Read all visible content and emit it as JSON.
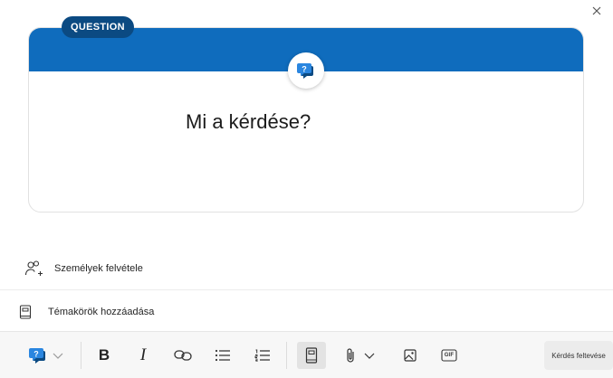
{
  "dialog": {
    "close_icon": "close-icon"
  },
  "card": {
    "badge_label": "QUESTION",
    "question_icon": "question-bubble-icon",
    "question_placeholder": "Mi a kérdése?",
    "question_value": "",
    "colors": {
      "band": "#0f6cbd",
      "badge": "#0b4a82"
    }
  },
  "options": {
    "add_people_label": "Személyek felvétele",
    "add_people_icon": "add-people-icon",
    "add_topics_label": "Témakörök hozzáadása",
    "add_topics_icon": "book-icon"
  },
  "toolbar": {
    "post_type_icon": "question-bubble-icon",
    "bold_label": "B",
    "italic_label": "I",
    "link_icon": "link-icon",
    "bulleted_list_icon": "bulleted-list-icon",
    "numbered_list_icon": "numbered-list-icon",
    "topic_icon": "book-icon",
    "attach_icon": "paperclip-icon",
    "image_icon": "image-icon",
    "gif_label": "GIF",
    "post_label": "Kérdés feltevése"
  }
}
